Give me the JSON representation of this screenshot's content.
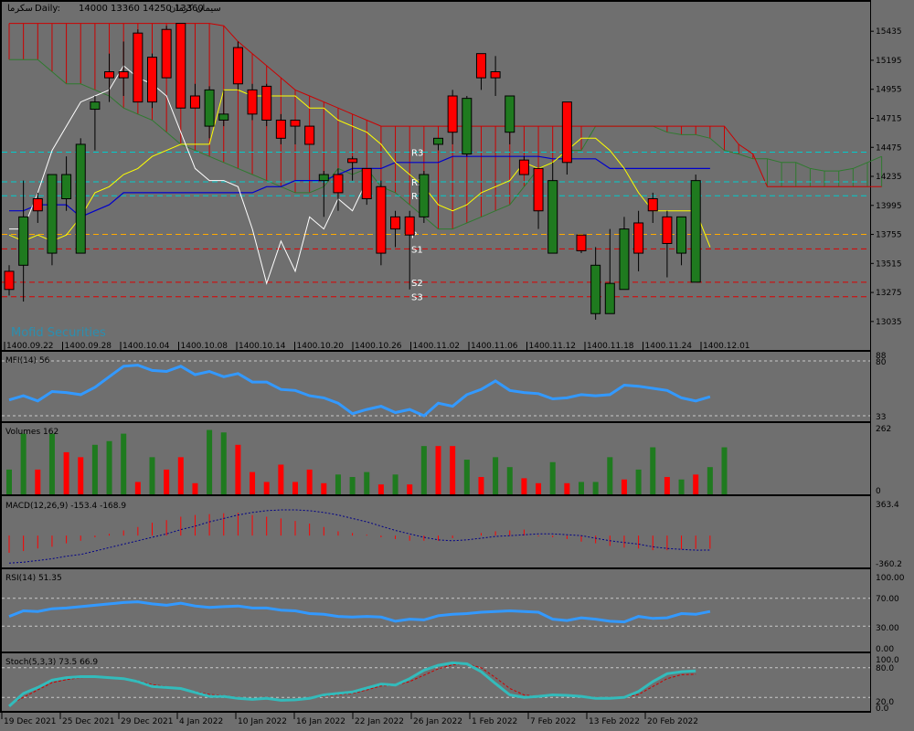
{
  "header": {
    "symbol": "سکرما",
    "timeframe": "Daily:",
    "ohlc": "14000 13360 14250 13360",
    "symbol_name": "سیمان کرمان"
  },
  "watermark": "Mofid Securities",
  "colors": {
    "panel_bg": "#6f6f6f",
    "grid_line": "#c8c8c8",
    "bull": "#1f7a1f",
    "bear": "#ff0000",
    "tenkan": "#ffff00",
    "kijun": "#0000cc",
    "chikou": "#ffffff",
    "span_a": "#2f7a2f",
    "span_b": "#cc0000",
    "mfi": "#3399ff",
    "rsi": "#3399ff",
    "stoch_main": "#33bbbb",
    "stoch_signal": "#cc0000",
    "macd_signal": "#000088",
    "pivot_cyan": "#00cccc",
    "pivot_orange": "#ffaa00",
    "pivot_red": "#dd0000"
  },
  "price_axis_labels": [
    "15435",
    "15195",
    "14955",
    "14715",
    "14475",
    "14235",
    "13995",
    "13755",
    "13515",
    "13275",
    "13035"
  ],
  "time_axis_top": [
    "1400.09.22",
    "1400.09.28",
    "1400.10.04",
    "1400.10.08",
    "1400.10.14",
    "1400.10.20",
    "1400.10.26",
    "1400.11.02",
    "1400.11.06",
    "1400.11.12",
    "1400.11.18",
    "1400.11.24",
    "1400.12.01"
  ],
  "time_axis_bottom": [
    "19 Dec 2021",
    "25 Dec 2021",
    "29 Dec 2021",
    "4 Jan 2022",
    "10 Jan 2022",
    "16 Jan 2022",
    "22 Jan 2022",
    "26 Jan 2022",
    "1 Feb 2022",
    "7 Feb 2022",
    "13 Feb 2022",
    "20 Feb 2022"
  ],
  "pivots": [
    {
      "label": "R3",
      "value": 14435,
      "color": "cyan"
    },
    {
      "label": "R2",
      "value": 14190,
      "color": "cyan"
    },
    {
      "label": "R1",
      "value": 14075,
      "color": "cyan"
    },
    {
      "label": "P",
      "value": 13755,
      "color": "orange"
    },
    {
      "label": "S1",
      "value": 13635,
      "color": "red"
    },
    {
      "label": "S2",
      "value": 13360,
      "color": "red"
    },
    {
      "label": "S3",
      "value": 13240,
      "color": "red"
    }
  ],
  "panels": {
    "mfi": {
      "title": "MFI(14) 56",
      "axis": [
        "88",
        "80",
        "33"
      ]
    },
    "volumes": {
      "title": "Volumes 162",
      "axis": [
        "262",
        "0"
      ]
    },
    "macd": {
      "title": "MACD(12,26,9) -153.4 -168.9",
      "axis": [
        "363.4",
        "-360.2"
      ]
    },
    "rsi": {
      "title": "RSI(14) 51.35",
      "axis": [
        "100.00",
        "70.00",
        "30.00",
        "0.00"
      ]
    },
    "stoch": {
      "title": "Stoch(5,3,3) 73.5 66.9",
      "axis": [
        "100.0",
        "80.0",
        "20.0",
        "0.0"
      ]
    }
  },
  "chart_data": {
    "type": "candlestick",
    "price_ylim": [
      12860,
      15580
    ],
    "candles": [
      {
        "o": 13450,
        "h": 13500,
        "l": 13250,
        "c": 13300
      },
      {
        "o": 13500,
        "h": 14200,
        "l": 13200,
        "c": 13900
      },
      {
        "o": 14050,
        "h": 14100,
        "l": 13850,
        "c": 13950
      },
      {
        "o": 13600,
        "h": 14250,
        "l": 13500,
        "c": 14250
      },
      {
        "o": 14050,
        "h": 14400,
        "l": 13950,
        "c": 14250
      },
      {
        "o": 13600,
        "h": 14550,
        "l": 13600,
        "c": 14500
      },
      {
        "o": 14790,
        "h": 14900,
        "l": 14450,
        "c": 14850
      },
      {
        "o": 15100,
        "h": 15250,
        "l": 14850,
        "c": 15050
      },
      {
        "o": 15100,
        "h": 15350,
        "l": 14900,
        "c": 15050
      },
      {
        "o": 15420,
        "h": 15450,
        "l": 14850,
        "c": 14850
      },
      {
        "o": 15220,
        "h": 15250,
        "l": 14800,
        "c": 14850
      },
      {
        "o": 15450,
        "h": 15480,
        "l": 15050,
        "c": 15050
      },
      {
        "o": 15500,
        "h": 15500,
        "l": 14900,
        "c": 14800
      },
      {
        "o": 14900,
        "h": 15000,
        "l": 14800,
        "c": 14800
      },
      {
        "o": 14650,
        "h": 14980,
        "l": 14550,
        "c": 14950
      },
      {
        "o": 14700,
        "h": 14950,
        "l": 14650,
        "c": 14750
      },
      {
        "o": 15300,
        "h": 15350,
        "l": 14950,
        "c": 15000
      },
      {
        "o": 14950,
        "h": 15000,
        "l": 14700,
        "c": 14750
      },
      {
        "o": 14980,
        "h": 15000,
        "l": 14650,
        "c": 14700
      },
      {
        "o": 14700,
        "h": 14750,
        "l": 14500,
        "c": 14550
      },
      {
        "o": 14700,
        "h": 14700,
        "l": 14500,
        "c": 14650
      },
      {
        "o": 14650,
        "h": 14650,
        "l": 14500,
        "c": 14500
      },
      {
        "o": 14200,
        "h": 14280,
        "l": 13900,
        "c": 14250
      },
      {
        "o": 14250,
        "h": 14300,
        "l": 13950,
        "c": 14100
      },
      {
        "o": 14380,
        "h": 14400,
        "l": 14200,
        "c": 14350
      },
      {
        "o": 14300,
        "h": 14300,
        "l": 14000,
        "c": 14050
      },
      {
        "o": 14150,
        "h": 14200,
        "l": 13500,
        "c": 13600
      },
      {
        "o": 13900,
        "h": 13950,
        "l": 13650,
        "c": 13800
      },
      {
        "o": 13900,
        "h": 13950,
        "l": 13300,
        "c": 13750
      },
      {
        "o": 13900,
        "h": 14280,
        "l": 13850,
        "c": 14250
      },
      {
        "o": 14500,
        "h": 14550,
        "l": 14450,
        "c": 14550
      },
      {
        "o": 14900,
        "h": 14950,
        "l": 14500,
        "c": 14600
      },
      {
        "o": 14420,
        "h": 14900,
        "l": 14400,
        "c": 14880
      },
      {
        "o": 15250,
        "h": 15250,
        "l": 14950,
        "c": 15050
      },
      {
        "o": 15100,
        "h": 15230,
        "l": 14900,
        "c": 15050
      },
      {
        "o": 14600,
        "h": 14900,
        "l": 14500,
        "c": 14900
      },
      {
        "o": 14370,
        "h": 14400,
        "l": 14250,
        "c": 14250
      },
      {
        "o": 14300,
        "h": 14300,
        "l": 13800,
        "c": 13950
      },
      {
        "o": 13600,
        "h": 14350,
        "l": 13600,
        "c": 14200
      },
      {
        "o": 14850,
        "h": 14850,
        "l": 14250,
        "c": 14350
      },
      {
        "o": 13750,
        "h": 13750,
        "l": 13600,
        "c": 13620
      },
      {
        "o": 13100,
        "h": 13650,
        "l": 13050,
        "c": 13500
      },
      {
        "o": 13100,
        "h": 13800,
        "l": 13100,
        "c": 13350
      },
      {
        "o": 13300,
        "h": 13900,
        "l": 13300,
        "c": 13800
      },
      {
        "o": 13850,
        "h": 13950,
        "l": 13450,
        "c": 13600
      },
      {
        "o": 14050,
        "h": 14100,
        "l": 13850,
        "c": 13950
      },
      {
        "o": 13900,
        "h": 13950,
        "l": 13400,
        "c": 13680
      },
      {
        "o": 13600,
        "h": 13900,
        "l": 13500,
        "c": 13900
      },
      {
        "o": 13360,
        "h": 14250,
        "l": 13360,
        "c": 14200
      }
    ],
    "tenkan": [
      13750,
      13700,
      13750,
      13700,
      13750,
      13900,
      14100,
      14150,
      14250,
      14300,
      14400,
      14450,
      14500,
      14500,
      14500,
      14950,
      14950,
      14900,
      14900,
      14900,
      14900,
      14800,
      14800,
      14700,
      14650,
      14600,
      14500,
      14350,
      14250,
      14150,
      14000,
      13950,
      14000,
      14100,
      14150,
      14200,
      14350,
      14300,
      14350,
      14450,
      14550,
      14550,
      14450,
      14300,
      14100,
      13950,
      13950,
      13950,
      13950,
      13650
    ],
    "kijun": [
      13950,
      13950,
      14000,
      14000,
      14000,
      13900,
      13950,
      14000,
      14100,
      14100,
      14100,
      14100,
      14100,
      14100,
      14100,
      14100,
      14100,
      14100,
      14150,
      14150,
      14200,
      14200,
      14200,
      14250,
      14300,
      14300,
      14300,
      14350,
      14350,
      14350,
      14350,
      14400,
      14400,
      14400,
      14400,
      14400,
      14400,
      14400,
      14380,
      14380,
      14380,
      14380,
      14300,
      14300,
      14300,
      14300,
      14300,
      14300,
      14300,
      14300
    ],
    "span_a": [
      15200,
      15200,
      15200,
      15100,
      15000,
      15000,
      14950,
      14900,
      14800,
      14750,
      14700,
      14600,
      14500,
      14450,
      14400,
      14350,
      14300,
      14250,
      14200,
      14150,
      14100,
      14100,
      14150,
      14300,
      14250,
      14300,
      14150,
      14100,
      14000,
      13900,
      13800,
      13800,
      13850,
      13900,
      13950,
      14000,
      14150,
      14300,
      14350,
      14450,
      14450,
      14650,
      14650,
      14650,
      14650,
      14650,
      14600,
      14580,
      14580,
      14550,
      14450,
      14420,
      14380,
      14380,
      14350,
      14350,
      14300,
      14280,
      14280,
      14300,
      14350,
      14400
    ],
    "span_b": [
      15500,
      15500,
      15500,
      15500,
      15500,
      15500,
      15500,
      15500,
      15500,
      15500,
      15500,
      15500,
      15500,
      15500,
      15500,
      15480,
      15350,
      15250,
      15150,
      15050,
      14950,
      14900,
      14850,
      14800,
      14750,
      14700,
      14650,
      14650,
      14650,
      14650,
      14650,
      14650,
      14650,
      14650,
      14650,
      14650,
      14650,
      14650,
      14650,
      14650,
      14650,
      14650,
      14650,
      14650,
      14650,
      14650,
      14650,
      14650,
      14650,
      14650,
      14650,
      14500,
      14420,
      14150,
      14150,
      14150,
      14150,
      14150,
      14150,
      14150,
      14150,
      14150
    ],
    "chikou": [
      13800,
      13800,
      14100,
      14450,
      14650,
      14850,
      14900,
      14950,
      15150,
      15050,
      15000,
      14900,
      14600,
      14300,
      14200,
      14200,
      14150,
      13800,
      13350,
      13700,
      13450,
      13900,
      13800,
      14050,
      13950,
      14200
    ],
    "mfi": [
      48,
      52,
      47,
      56,
      55,
      53,
      60,
      70,
      80,
      81,
      76,
      75,
      80,
      72,
      75,
      70,
      73,
      65,
      65,
      58,
      57,
      52,
      50,
      45,
      35,
      39,
      42,
      36,
      39,
      33,
      45,
      42,
      53,
      58,
      66,
      57,
      55,
      54,
      49,
      50,
      53,
      52,
      53,
      62,
      61,
      59,
      57,
      50,
      47,
      51
    ],
    "volumes": [
      {
        "v": 100,
        "dir": "up"
      },
      {
        "v": 245,
        "dir": "up"
      },
      {
        "v": 100,
        "dir": "down"
      },
      {
        "v": 245,
        "dir": "up"
      },
      {
        "v": 170,
        "dir": "down"
      },
      {
        "v": 150,
        "dir": "down"
      },
      {
        "v": 200,
        "dir": "up"
      },
      {
        "v": 215,
        "dir": "up"
      },
      {
        "v": 245,
        "dir": "up"
      },
      {
        "v": 50,
        "dir": "down"
      },
      {
        "v": 150,
        "dir": "up"
      },
      {
        "v": 100,
        "dir": "down"
      },
      {
        "v": 150,
        "dir": "down"
      },
      {
        "v": 45,
        "dir": "down"
      },
      {
        "v": 260,
        "dir": "up"
      },
      {
        "v": 250,
        "dir": "up"
      },
      {
        "v": 200,
        "dir": "down"
      },
      {
        "v": 90,
        "dir": "down"
      },
      {
        "v": 50,
        "dir": "down"
      },
      {
        "v": 120,
        "dir": "down"
      },
      {
        "v": 50,
        "dir": "down"
      },
      {
        "v": 100,
        "dir": "down"
      },
      {
        "v": 45,
        "dir": "down"
      },
      {
        "v": 80,
        "dir": "up"
      },
      {
        "v": 70,
        "dir": "up"
      },
      {
        "v": 90,
        "dir": "up"
      },
      {
        "v": 40,
        "dir": "down"
      },
      {
        "v": 80,
        "dir": "up"
      },
      {
        "v": 40,
        "dir": "down"
      },
      {
        "v": 195,
        "dir": "up"
      },
      {
        "v": 195,
        "dir": "down"
      },
      {
        "v": 195,
        "dir": "down"
      },
      {
        "v": 140,
        "dir": "up"
      },
      {
        "v": 70,
        "dir": "down"
      },
      {
        "v": 150,
        "dir": "up"
      },
      {
        "v": 110,
        "dir": "up"
      },
      {
        "v": 65,
        "dir": "down"
      },
      {
        "v": 45,
        "dir": "down"
      },
      {
        "v": 130,
        "dir": "up"
      },
      {
        "v": 45,
        "dir": "down"
      },
      {
        "v": 50,
        "dir": "up"
      },
      {
        "v": 50,
        "dir": "up"
      },
      {
        "v": 150,
        "dir": "up"
      },
      {
        "v": 60,
        "dir": "down"
      },
      {
        "v": 100,
        "dir": "up"
      },
      {
        "v": 190,
        "dir": "up"
      },
      {
        "v": 70,
        "dir": "down"
      },
      {
        "v": 60,
        "dir": "up"
      },
      {
        "v": 80,
        "dir": "down"
      },
      {
        "v": 110,
        "dir": "up"
      },
      {
        "v": 190,
        "dir": "up"
      }
    ],
    "macd_ylim": [
      -360.2,
      363.4
    ],
    "macd_hist": [
      -200,
      -180,
      -150,
      -130,
      -90,
      -60,
      -20,
      20,
      60,
      100,
      150,
      180,
      220,
      240,
      250,
      260,
      265,
      240,
      220,
      200,
      170,
      140,
      100,
      50,
      30,
      10,
      -20,
      -40,
      -60,
      -60,
      -60,
      -30,
      0,
      30,
      50,
      60,
      70,
      -10,
      -20,
      -40,
      -70,
      -90,
      -120,
      -140,
      -150,
      -170,
      -170,
      -160,
      -155,
      -153
    ],
    "macd_signal": [
      -320,
      -310,
      -290,
      -270,
      -240,
      -220,
      -180,
      -140,
      -100,
      -60,
      -20,
      20,
      70,
      110,
      160,
      200,
      240,
      270,
      290,
      300,
      300,
      290,
      270,
      240,
      200,
      160,
      110,
      60,
      20,
      -20,
      -50,
      -60,
      -50,
      -30,
      -10,
      0,
      10,
      20,
      20,
      10,
      0,
      -30,
      -60,
      -80,
      -100,
      -130,
      -150,
      -160,
      -170,
      -169
    ],
    "rsi": [
      44,
      52,
      51,
      55,
      56,
      58,
      60,
      62,
      64,
      65,
      62,
      60,
      63,
      59,
      57,
      58,
      59,
      56,
      56,
      53,
      52,
      48,
      47,
      44,
      43,
      44,
      43,
      37,
      40,
      39,
      45,
      47,
      48,
      50,
      51,
      52,
      51,
      50,
      40,
      38,
      42,
      40,
      37,
      36,
      44,
      41,
      42,
      48,
      47,
      51
    ],
    "stoch_k": [
      2,
      28,
      40,
      55,
      60,
      62,
      62,
      60,
      58,
      52,
      42,
      40,
      38,
      30,
      22,
      22,
      18,
      16,
      18,
      14,
      15,
      18,
      25,
      28,
      31,
      39,
      47,
      45,
      58,
      75,
      85,
      90,
      88,
      72,
      48,
      25,
      20,
      22,
      25,
      24,
      22,
      18,
      18,
      20,
      32,
      52,
      68,
      72,
      73.5
    ],
    "stoch_d": [
      5,
      20,
      35,
      50,
      56,
      60,
      61,
      61,
      58,
      54,
      46,
      42,
      38,
      32,
      26,
      24,
      20,
      17,
      17,
      15,
      15,
      17,
      22,
      25,
      28,
      35,
      43,
      44,
      52,
      65,
      78,
      86,
      88,
      80,
      60,
      38,
      25,
      22,
      23,
      24,
      23,
      20,
      19,
      19,
      26,
      42,
      58,
      66,
      66.9
    ]
  }
}
